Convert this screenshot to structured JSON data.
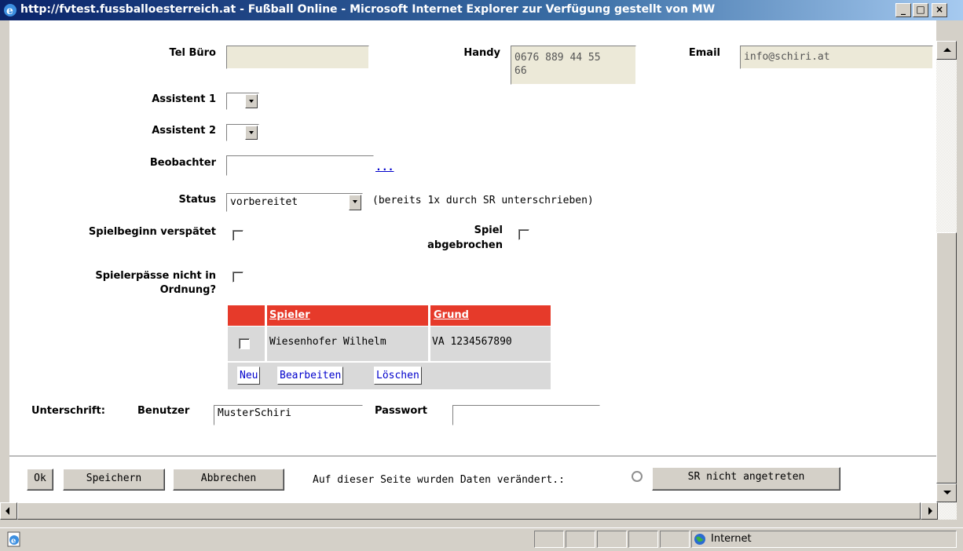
{
  "window": {
    "title": "http://fvtest.fussballoesterreich.at - Fußball Online - Microsoft Internet Explorer  zur Verfügung gestellt von MW",
    "minimize": "_",
    "maximize": "□",
    "close": "×"
  },
  "contact": {
    "tel_label": "Tel Büro",
    "tel_value": "",
    "handy_label": "Handy",
    "handy_value": "0676 889 44 55\n66",
    "email_label": "Email",
    "email_value": "info@schiri.at"
  },
  "assistent1_label": "Assistent 1",
  "assistent2_label": "Assistent 2",
  "beobachter_label": "Beobachter",
  "beobachter_value": "",
  "beobachter_link": "...",
  "status": {
    "label": "Status",
    "selected": "vorbereitet",
    "note": "(bereits 1x durch SR unterschrieben)"
  },
  "spielbeginn_label": "Spielbeginn verspätet",
  "spiel_abgebrochen_line1": "Spiel",
  "spiel_abgebrochen_line2": "abgebrochen",
  "spielerpaesse_line1": "Spielerpässe nicht in",
  "spielerpaesse_line2": "Ordnung?",
  "table": {
    "headers": [
      "Spieler",
      "Grund"
    ],
    "rows": [
      {
        "spieler": "Wiesenhofer Wilhelm",
        "grund": "VA 1234567890"
      }
    ],
    "buttons": {
      "neu": "Neu",
      "bearbeiten": "Bearbeiten",
      "loeschen": "Löschen"
    }
  },
  "unterschrift": {
    "label": "Unterschrift:",
    "benutzer_label": "Benutzer",
    "benutzer_value": "MusterSchiri",
    "passwort_label": "Passwort",
    "passwort_value": ""
  },
  "footer": {
    "ok": "Ok",
    "speichern": "Speichern",
    "abbrechen": "Abbrechen",
    "changed_text": "Auf dieser Seite wurden Daten verändert.:",
    "sr_nicht": "SR nicht angetreten"
  },
  "statusbar": {
    "zone": "Internet"
  }
}
